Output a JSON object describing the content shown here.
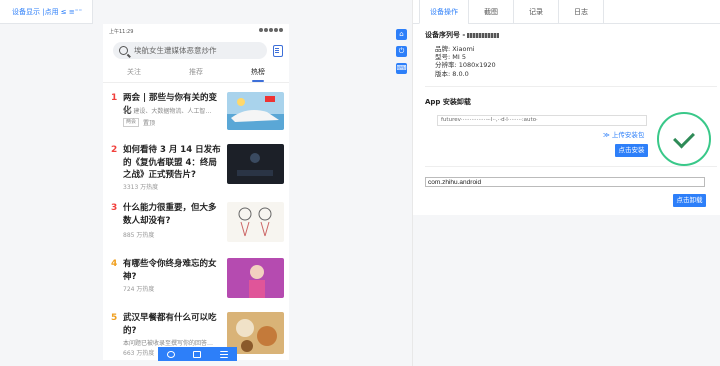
{
  "top_tab": {
    "label": "设备显示 |点用 ≤ ≡⁼⁼"
  },
  "phone": {
    "status": {
      "time": "上午11:29",
      "right": "··· ▲ ■ ■"
    },
    "search": {
      "placeholder": "埃航女生遭媒体恶意炒作"
    },
    "tabs": [
      "关注",
      "推荐",
      "热榜"
    ],
    "active_tab": "热榜",
    "hot_items": [
      {
        "rank": "1",
        "title": "两会 | 那些与你有关的变化",
        "sub": "5G 建设、大数据物流、人工智…",
        "tag": "两会",
        "tag_text": "置顶",
        "heat": ""
      },
      {
        "rank": "2",
        "title": "如何看待 3 月 14 日发布的《复仇者联盟 4：终局之战》正式预告片?",
        "sub": "",
        "heat": "3313 万热度"
      },
      {
        "rank": "3",
        "title": "什么能力很重要，但大多数人却没有?",
        "sub": "",
        "heat": "885 万热度"
      },
      {
        "rank": "4",
        "title": "有哪些令你终身难忘的女神?",
        "sub": "",
        "heat": "724 万热度"
      },
      {
        "rank": "5",
        "title": "武汉早餐都有什么可以吃的?",
        "sub": "本问题已被收录至撰写你的回答…",
        "heat": "663 万热度"
      }
    ]
  },
  "right": {
    "tabs": [
      "设备操作",
      "截图",
      "记录",
      "日志"
    ],
    "device_section": {
      "title": "设备序列号 -",
      "brand": "品牌: Xiaomi",
      "model": "型号: MI 5",
      "resolution": "分辨率: 1080x1920",
      "version": "版本: 8.0.0"
    },
    "install_section": {
      "title": "App 安装卸载",
      "file": "futurev···············-·l··,··d·l········:auto·",
      "upload_link": "≫ 上传安装包",
      "install_button": "点击安装"
    },
    "uninstall_section": {
      "package": "com.zhihu.android",
      "uninstall_button": "点击卸载"
    }
  },
  "colors": {
    "accent": "#2d7ff9",
    "hot_red": "#f1403c",
    "hot_orange": "#f0a020",
    "success": "#39c889"
  }
}
